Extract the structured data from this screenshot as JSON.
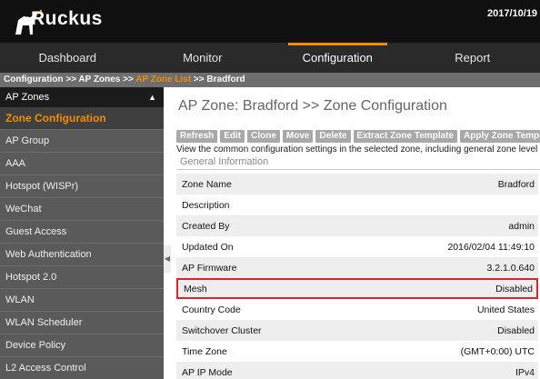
{
  "header": {
    "brand": "Ruckus",
    "datetime": "2017/10/19"
  },
  "nav": [
    {
      "label": "Dashboard",
      "active": false
    },
    {
      "label": "Monitor",
      "active": false
    },
    {
      "label": "Configuration",
      "active": true
    },
    {
      "label": "Report",
      "active": false
    }
  ],
  "breadcrumb": {
    "part1": "Configuration >> AP Zones >> ",
    "link": "AP Zone List",
    "part2": " >> Bradford"
  },
  "sidebar": {
    "header": "AP Zones",
    "items": [
      {
        "label": "Zone Configuration",
        "active": true
      },
      {
        "label": "AP Group"
      },
      {
        "label": "AAA"
      },
      {
        "label": "Hotspot (WISPr)"
      },
      {
        "label": "WeChat"
      },
      {
        "label": "Guest Access"
      },
      {
        "label": "Web Authentication"
      },
      {
        "label": "Hotspot 2.0"
      },
      {
        "label": "WLAN"
      },
      {
        "label": "WLAN Scheduler"
      },
      {
        "label": "Device Policy"
      },
      {
        "label": "L2 Access Control"
      }
    ]
  },
  "main": {
    "title": "AP Zone: Bradford >> Zone Configuration",
    "toolbar": [
      "Refresh",
      "Edit",
      "Clone",
      "Move",
      "Delete",
      "Extract Zone Template",
      "Apply Zone Template"
    ],
    "description": "View the common configuration settings in the selected zone, including general zone level settings.",
    "section_title": "General Information",
    "rows": [
      {
        "label": "Zone Name",
        "value": "Bradford"
      },
      {
        "label": "Description",
        "value": ""
      },
      {
        "label": "Created By",
        "value": "admin"
      },
      {
        "label": "Updated On",
        "value": "2016/02/04 11:49:10"
      },
      {
        "label": "AP Firmware",
        "value": "3.2.1.0.640"
      },
      {
        "label": "Mesh",
        "value": "Disabled",
        "highlight": true
      },
      {
        "label": "Country Code",
        "value": "United States"
      },
      {
        "label": "Switchover Cluster",
        "value": "Disabled"
      },
      {
        "label": "Time Zone",
        "value": "(GMT+0:00) UTC"
      },
      {
        "label": "AP IP Mode",
        "value": "IPv4"
      }
    ]
  },
  "colors": {
    "accent": "#f28c00",
    "highlight_border": "#d8262a"
  }
}
